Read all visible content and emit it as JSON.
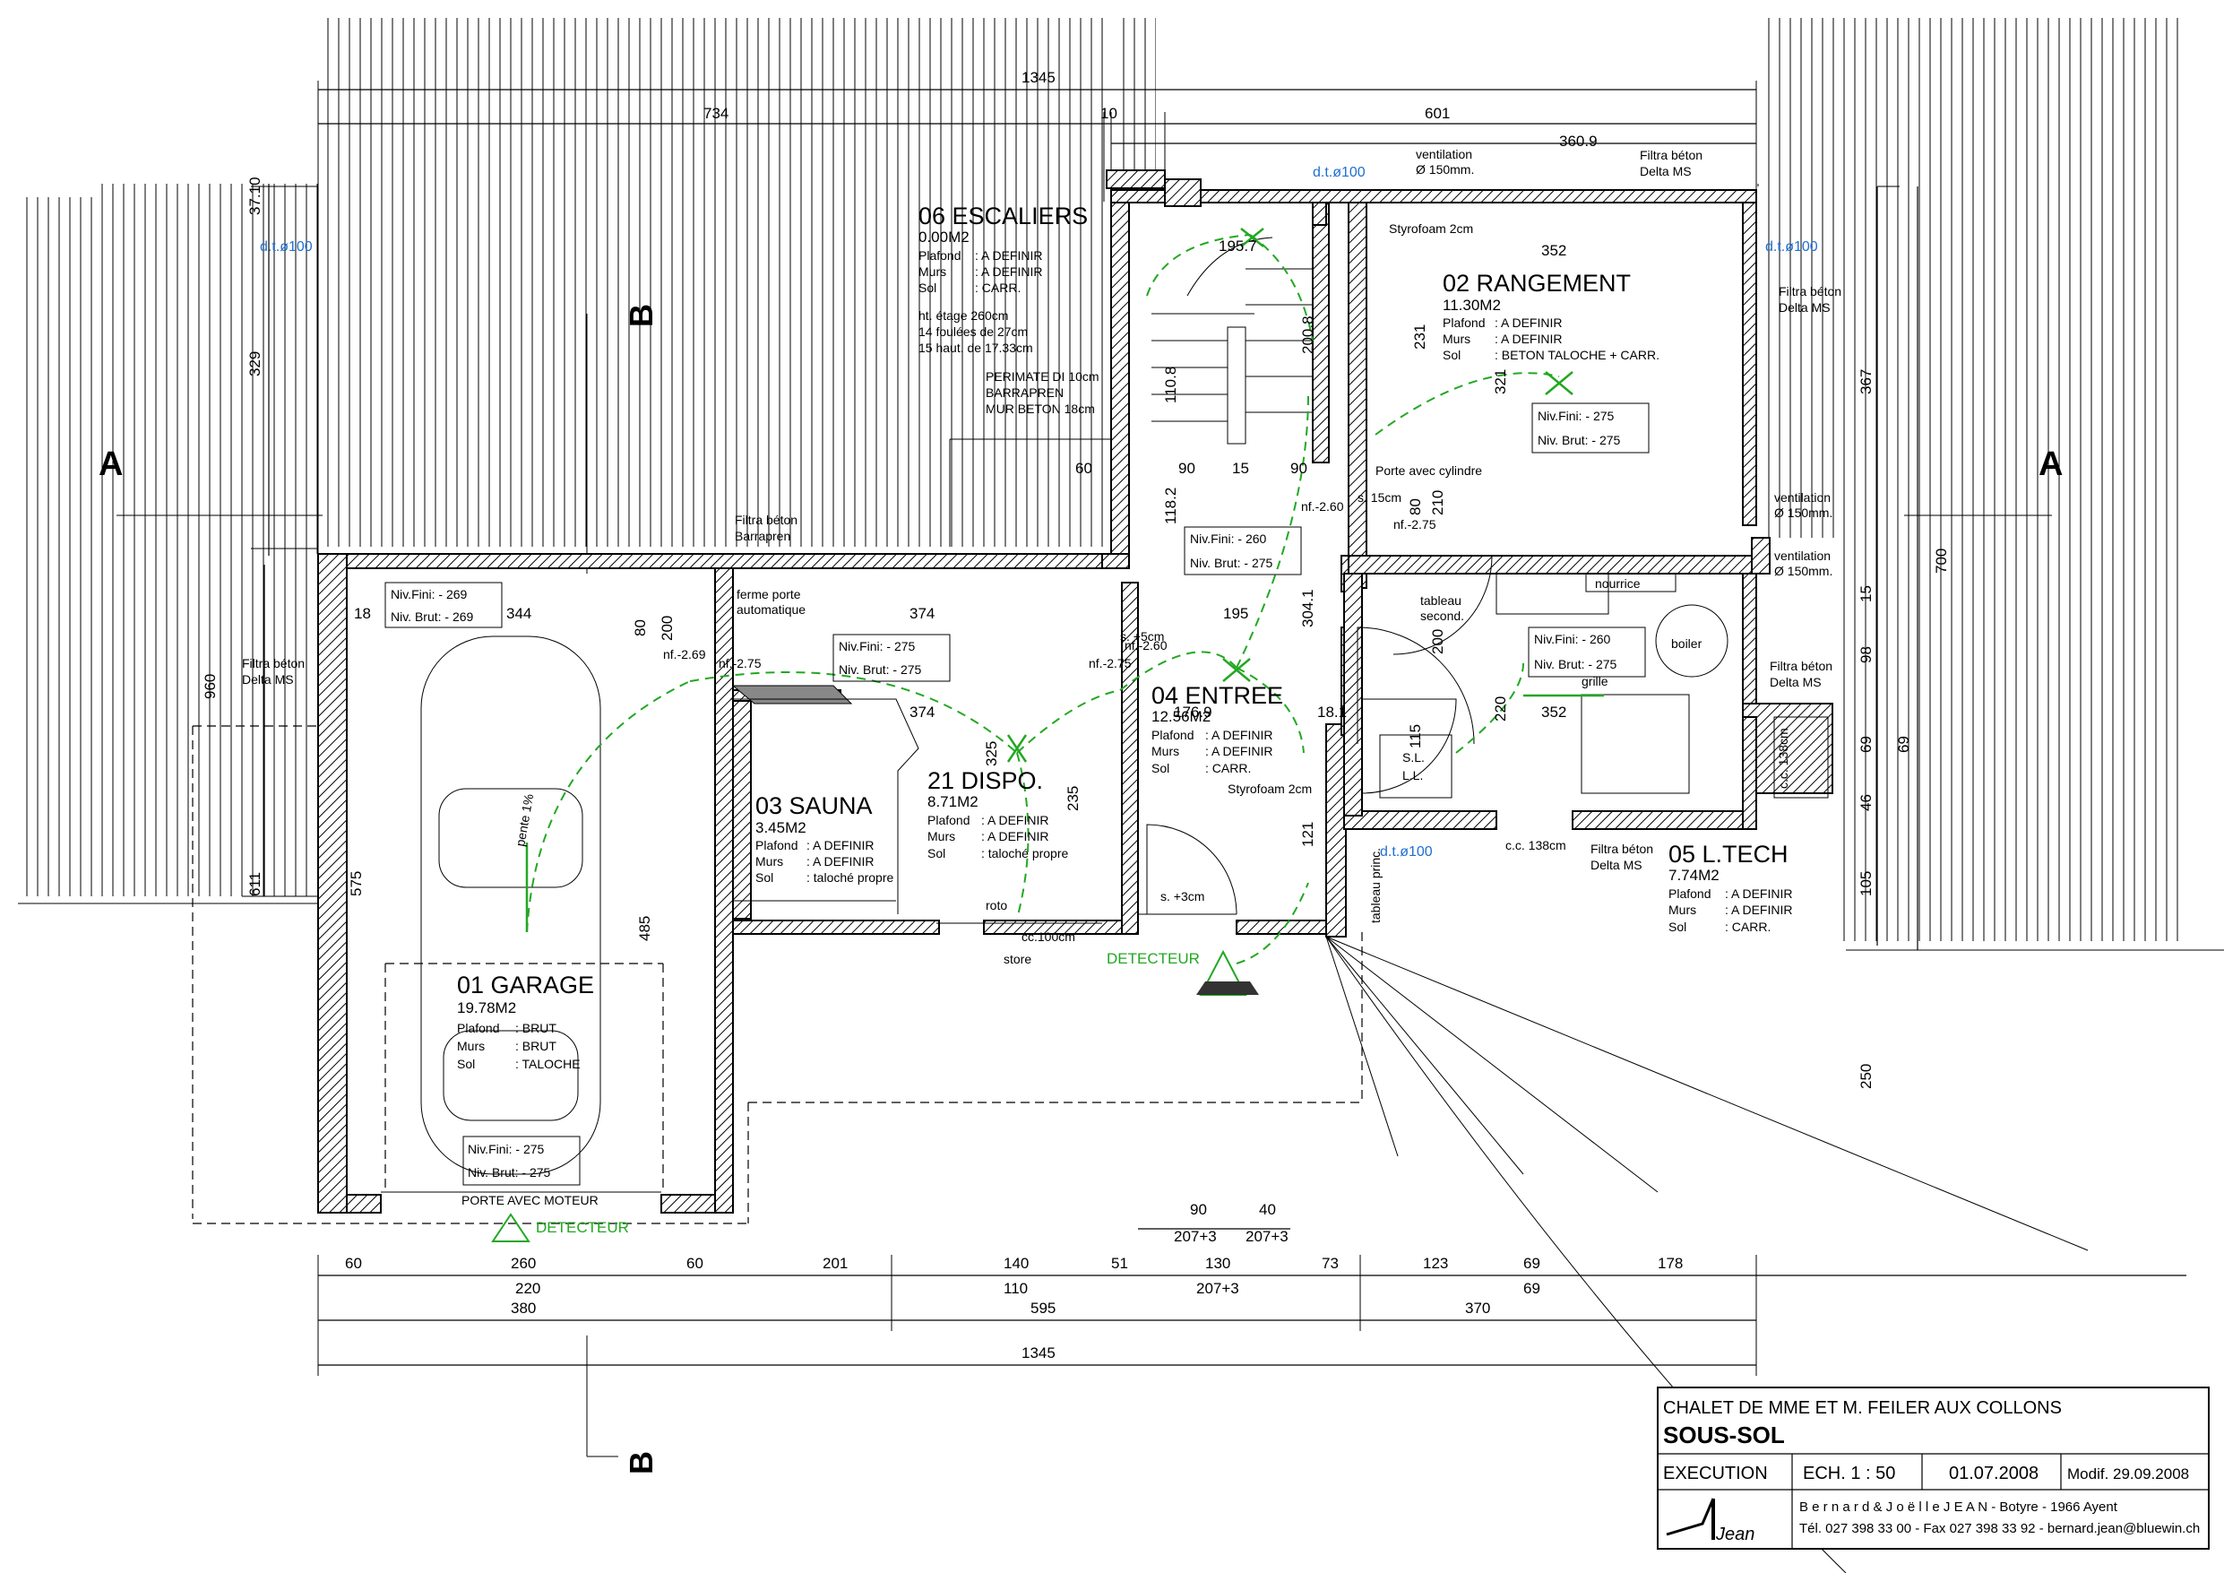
{
  "title_block": {
    "project": "CHALET DE MME ET M. FEILER AUX COLLONS",
    "sheet": "SOUS-SOL",
    "phase": "EXECUTION",
    "scale": "ECH.   1 : 50",
    "date": "01.07.2008",
    "modified": "Modif. 29.09.2008",
    "architect": "B e r n a r d   &   J o ë l l e   J E A N   - Botyre - 1966  Ayent",
    "contact": "Tél. 027 398 33 00 - Fax 027 398 33 92 - bernard.jean@bluewin.ch",
    "logo_text": "Jean"
  },
  "section_marks": {
    "a_left": "A",
    "a_right": "A",
    "b_top": "B",
    "b_bottom": "B"
  },
  "rooms": {
    "garage": {
      "title": "01 GARAGE",
      "area": "19.78M2",
      "k1": "Plafond",
      "v1": ": BRUT",
      "k2": "Murs",
      "v2": ": BRUT",
      "k3": "Sol",
      "v3": ": TALOCHE",
      "niv_fini": "Niv.Fini:  - 275",
      "niv_brut": "Niv. Brut:  - 275"
    },
    "rangement": {
      "title": "02 RANGEMENT",
      "area": "11.30M2",
      "k1": "Plafond",
      "v1": ": A DEFINIR",
      "k2": "Murs",
      "v2": ": A DEFINIR",
      "k3": "Sol",
      "v3": ": BETON TALOCHE + CARR.",
      "niv_fini": "Niv.Fini:  - 275",
      "niv_brut": "Niv. Brut:  - 275"
    },
    "sauna": {
      "title": "03 SAUNA",
      "area": "3.45M2",
      "k1": "Plafond",
      "v1": ": A DEFINIR",
      "k2": "Murs",
      "v2": ": A DEFINIR",
      "k3": "Sol",
      "v3": ": taloché propre"
    },
    "entree": {
      "title": "04 ENTREE",
      "area": "12.56M2",
      "k1": "Plafond",
      "v1": ": A DEFINIR",
      "k2": "Murs",
      "v2": ": A DEFINIR",
      "k3": "Sol",
      "v3": ": CARR."
    },
    "ltech": {
      "title": "05 L.TECH",
      "area": "7.74M2",
      "k1": "Plafond",
      "v1": ": A DEFINIR",
      "k2": "Murs",
      "v2": ": A DEFINIR",
      "k3": "Sol",
      "v3": ": CARR."
    },
    "escaliers": {
      "title": "06 ESCALIERS",
      "area": "0.00M2",
      "k1": "Plafond",
      "v1": ": A DEFINIR",
      "k2": "Murs",
      "v2": ": A DEFINIR",
      "k3": "Sol",
      "v3": ": CARR.",
      "n1": "ht. étage 260cm",
      "n2": "14 foulées de 27cm",
      "n3": "15 haut. de 17.33cm",
      "p1": "PERIMATE DI 10cm",
      "p2": "BARRAPREN",
      "p3": "MUR BETON 18cm"
    },
    "dispo": {
      "title": "21 DISPO.",
      "area": "8.71M2",
      "k1": "Plafond",
      "v1": ": A DEFINIR",
      "k2": "Murs",
      "v2": ": A DEFINIR",
      "k3": "Sol",
      "v3": ": taloché propre"
    }
  },
  "levels": {
    "top_left_fini": "Niv.Fini:  - 269",
    "top_left_brut": "Niv. Brut:  - 269",
    "sauna_fini": "Niv.Fini:  - 275",
    "sauna_brut": "Niv. Brut:  - 275",
    "entree_fini": "Niv.Fini:  - 260",
    "entree_brut": "Niv. Brut:  - 275",
    "ltech_fini": "Niv.Fini:  - 260",
    "ltech_brut": "Niv. Brut:  - 275"
  },
  "annotations": {
    "ventilation1": "ventilation",
    "ventilation1b": "Ø 150mm.",
    "ventilation2": "ventilation",
    "ventilation2b": "Ø 150mm.",
    "ventilation3": "ventilation",
    "ventilation3b": "Ø 150mm.",
    "filtra1": "Filtra béton",
    "filtra1b": "Delta MS",
    "filtra2": "Filtra béton",
    "filtra2b": "Delta MS",
    "filtra3": "Filtra béton",
    "filtra3b": "Barrapren",
    "filtra4": "Filtra béton",
    "filtra4b": "Delta MS",
    "filtra5": "Filtra béton",
    "filtra5b": "Delta MS",
    "filtra6": "Filtra béton",
    "filtra6b": "Delta MS",
    "dt1": "d.t.ø100",
    "dt2": "d.t.ø100",
    "dt3": "d.t.ø100",
    "dt4": "d.t.ø100",
    "styro1": "Styrofoam 2cm",
    "styro2": "Styrofoam 2cm",
    "porte_cyl": "Porte avec cylindre",
    "ferme_porte": "ferme porte",
    "ferme_porte2": "automatique",
    "porte_moteur": "PORTE AVEC MOTEUR",
    "detecteur1": "DETECTEUR",
    "detecteur2": "DETECTEUR",
    "nourrice": "nourrice",
    "boiler": "boiler",
    "tableau": "tableau",
    "tableau2": "second.",
    "tableau_princ": "tableau princ.",
    "store": "store",
    "roto": "roto",
    "cc100": "cc.100cm",
    "cc138a": "c.c. 138cm",
    "cc138b": "c.c. 138cm",
    "grille": "grille",
    "s3cm": "s. +3cm",
    "s5cm": "s. +5cm",
    "s15cm": "s. 15cm",
    "nf260a": "nf.-2.60",
    "nf260b": "nf.-2.60",
    "nf275a": "nf.-2.75",
    "nf275b": "nf.-2.75",
    "nf269": "nf.-2.69",
    "nf275c": "nf.-2.75",
    "pente": "pente 1%",
    "sl": "S.L.",
    "ll": "L.L."
  },
  "dims": {
    "top_total": "1345",
    "top_734": "734",
    "top_10": "10",
    "top_601": "601",
    "top_3609": "360.9",
    "bot_60a": "60",
    "bot_260": "260",
    "bot_60b": "60",
    "bot_201": "201",
    "bot_140": "140",
    "bot_51": "51",
    "bot_130": "130",
    "bot_73": "73",
    "bot_123": "123",
    "bot_69": "69",
    "bot_178": "178",
    "bot_220": "220",
    "bot_110": "110",
    "bot_2073": "207+3",
    "bot_69b": "69",
    "bot_380": "380",
    "bot_595": "595",
    "bot_370": "370",
    "bot_total": "1345",
    "bot_90": "90",
    "bot_40": "40",
    "bot_2073a": "207+3",
    "bot_2073b": "207+3",
    "left_329": "329",
    "left_960": "960",
    "left_611": "611",
    "left_3710": "37.10",
    "right_367": "367",
    "right_700": "700",
    "right_98": "98",
    "right_69": "69",
    "right_46": "46",
    "right_105": "105",
    "right_250": "250",
    "right_15": "15",
    "right_69b": "69",
    "in_352a": "352",
    "in_352b": "352",
    "in_231": "231",
    "in_321": "321",
    "in_344": "344",
    "in_374a": "374",
    "in_374b": "374",
    "in_195": "195",
    "in_3041": "304.1",
    "in_1769": "176.9",
    "in_575": "575",
    "in_485": "485",
    "in_325": "325",
    "in_235": "235",
    "in_2008": "200.8",
    "in_1108": "110.8",
    "in_1182": "118.2",
    "in_90a": "90",
    "in_15": "15",
    "in_90b": "90",
    "in_60": "60",
    "in_1957": "195.7",
    "in_200a": "200",
    "in_200b": "200",
    "in_80a": "80",
    "in_80b": "80",
    "in_210": "210",
    "in_220": "220",
    "in_115": "115",
    "in_121": "121",
    "in_18": "18",
    "in_181": "18.1"
  }
}
